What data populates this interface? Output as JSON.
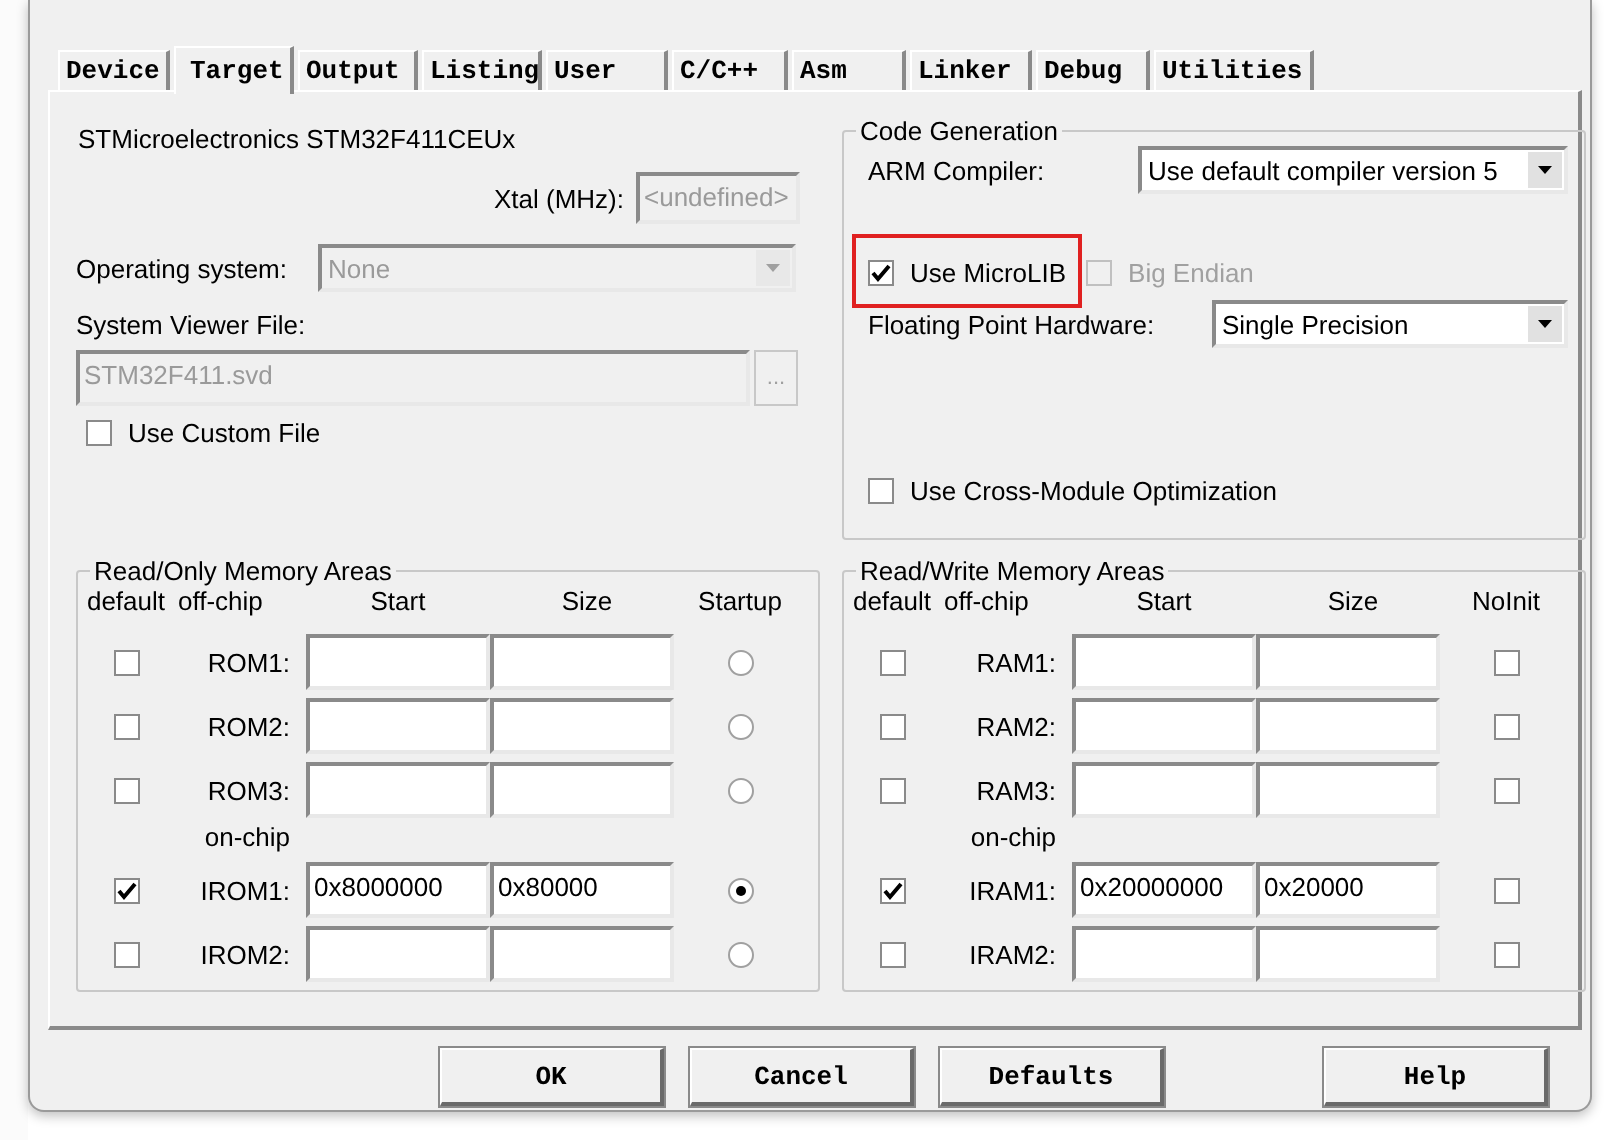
{
  "tabs": [
    {
      "label": "Device",
      "selected": false
    },
    {
      "label": "Target",
      "selected": true
    },
    {
      "label": "Output",
      "selected": false
    },
    {
      "label": "Listing",
      "selected": false
    },
    {
      "label": "User",
      "selected": false
    },
    {
      "label": "C/C++",
      "selected": false
    },
    {
      "label": "Asm",
      "selected": false
    },
    {
      "label": "Linker",
      "selected": false
    },
    {
      "label": "Debug",
      "selected": false
    },
    {
      "label": "Utilities",
      "selected": false
    }
  ],
  "device": "STMicroelectronics STM32F411CEUx",
  "xtal": {
    "label": "Xtal (MHz):",
    "value": "<undefined>",
    "disabled": true
  },
  "operating_system": {
    "label": "Operating system:",
    "value": "None",
    "disabled": true
  },
  "system_viewer": {
    "label": "System Viewer File:",
    "value": "STM32F411.svd",
    "browse": "...",
    "disabled": true
  },
  "use_custom_file": {
    "label": "Use Custom File",
    "checked": false
  },
  "code_generation": {
    "title": "Code Generation",
    "arm_compiler": {
      "label": "ARM Compiler:",
      "value": "Use default compiler version 5"
    },
    "options": [
      {
        "label": "Use MicroLIB",
        "checked": true,
        "disabled": false,
        "highlighted": true
      },
      {
        "label": "Big Endian",
        "checked": false,
        "disabled": true,
        "highlighted": false
      }
    ],
    "fpu": {
      "label": "Floating Point Hardware:",
      "value": "Single Precision"
    },
    "cross_module": {
      "label": "Use Cross-Module Optimization",
      "checked": false
    }
  },
  "memory_areas": [
    {
      "title": "Read/Only Memory Areas",
      "kind": "radio",
      "columns": [
        "default",
        "off-chip",
        "Start",
        "Size",
        "Startup"
      ],
      "on_chip_label": "on-chip",
      "off_chip_rows": [
        {
          "name": "ROM1:",
          "default": false,
          "selected": false
        },
        {
          "name": "ROM2:",
          "default": false,
          "selected": false
        },
        {
          "name": "ROM3:",
          "default": false,
          "selected": false
        }
      ],
      "on_chip_rows": [
        {
          "name": "IROM1:",
          "default": true,
          "start": "0x8000000",
          "size": "0x80000",
          "selected": true
        },
        {
          "name": "IROM2:",
          "default": false,
          "selected": false
        }
      ]
    },
    {
      "title": "Read/Write Memory Areas",
      "kind": "checkbox",
      "columns": [
        "default",
        "off-chip",
        "Start",
        "Size",
        "NoInit"
      ],
      "on_chip_label": "on-chip",
      "off_chip_rows": [
        {
          "name": "RAM1:",
          "default": false,
          "checked": false
        },
        {
          "name": "RAM2:",
          "default": false,
          "checked": false
        },
        {
          "name": "RAM3:",
          "default": false,
          "checked": false
        }
      ],
      "on_chip_rows": [
        {
          "name": "IRAM1:",
          "default": true,
          "start": "0x20000000",
          "size": "0x20000",
          "checked": false
        },
        {
          "name": "IRAM2:",
          "default": false,
          "checked": false
        }
      ]
    }
  ],
  "buttons": [
    {
      "label": "OK",
      "kind": "action"
    },
    {
      "label": "Cancel",
      "kind": "action"
    },
    {
      "label": "Defaults",
      "kind": "action"
    },
    {
      "label": "Help",
      "kind": "help"
    }
  ]
}
